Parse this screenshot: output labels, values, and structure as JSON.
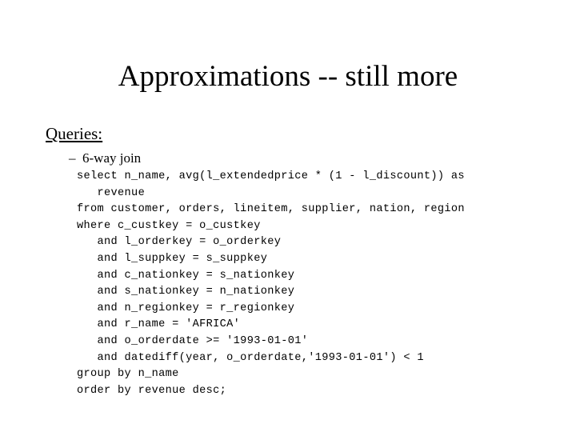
{
  "slide": {
    "title": "Approximations -- still more",
    "section_heading": "Queries:",
    "bullet": {
      "marker": "–",
      "label": "6-way join"
    },
    "code": {
      "language": "sql",
      "lines": [
        "select n_name, avg(l_extendedprice * (1 - l_discount)) as",
        "   revenue",
        "from customer, orders, lineitem, supplier, nation, region",
        "where c_custkey = o_custkey",
        "   and l_orderkey = o_orderkey",
        "   and l_suppkey = s_suppkey",
        "   and c_nationkey = s_nationkey",
        "   and s_nationkey = n_nationkey",
        "   and n_regionkey = r_regionkey",
        "   and r_name = 'AFRICA'",
        "   and o_orderdate >= '1993-01-01'",
        "   and datediff(year, o_orderdate,'1993-01-01') < 1",
        "group by n_name",
        "order by revenue desc;"
      ]
    },
    "colors": {
      "background": "#ffffff",
      "text": "#000000"
    }
  }
}
